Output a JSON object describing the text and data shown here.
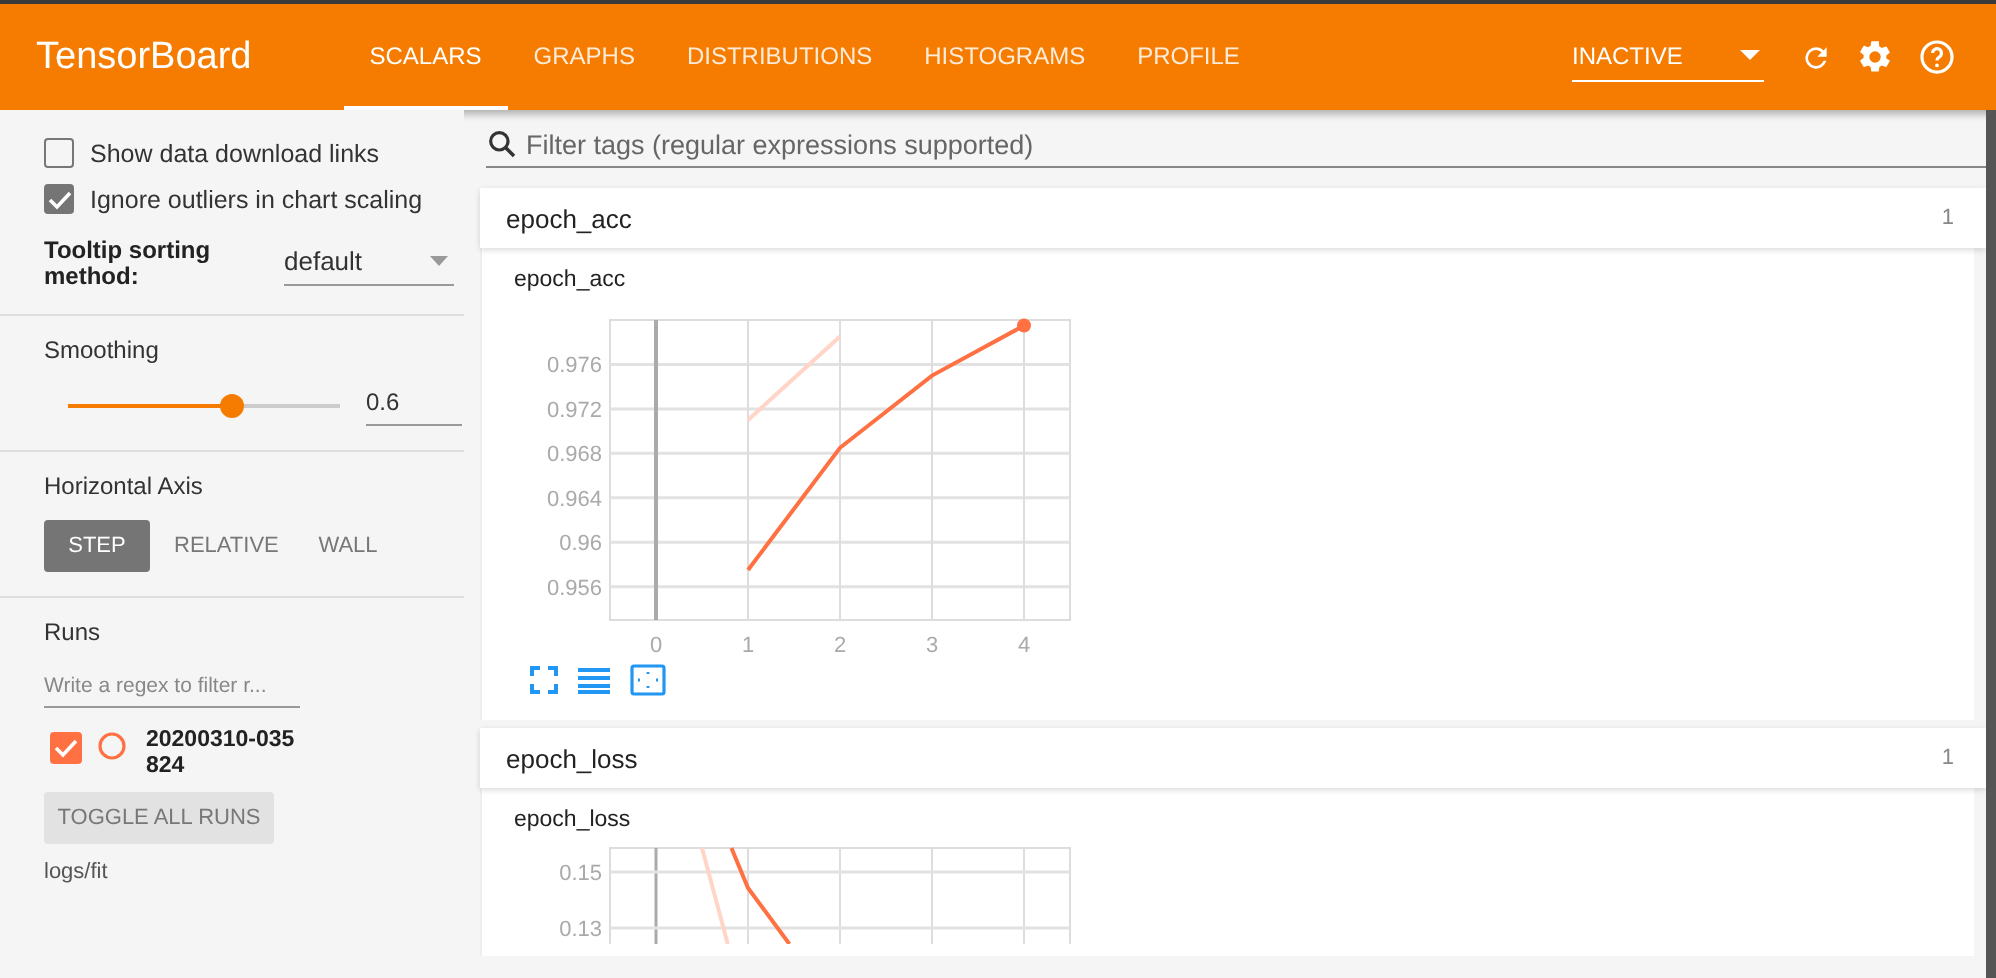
{
  "header": {
    "title": "TensorBoard",
    "tabs": [
      {
        "label": "SCALARS",
        "selected": true
      },
      {
        "label": "GRAPHS",
        "selected": false
      },
      {
        "label": "DISTRIBUTIONS",
        "selected": false
      },
      {
        "label": "HISTOGRAMS",
        "selected": false
      },
      {
        "label": "PROFILE",
        "selected": false
      }
    ],
    "run_select": {
      "value": "INACTIVE"
    }
  },
  "sidebar": {
    "options": [
      {
        "label": "Show data download links",
        "checked": false
      },
      {
        "label": "Ignore outliers in chart scaling",
        "checked": true
      }
    ],
    "tooltip_sorting": {
      "label": "Tooltip sorting method:",
      "value": "default"
    },
    "smoothing": {
      "label": "Smoothing",
      "level": 0.6,
      "value": "0.6"
    },
    "horizontal_axis": {
      "label": "Horizontal Axis",
      "options": [
        {
          "label": "STEP",
          "selected": true
        },
        {
          "label": "RELATIVE",
          "selected": false
        },
        {
          "label": "WALL",
          "selected": false
        }
      ]
    },
    "runs": {
      "label": "Runs",
      "placeholder": "Write a regex to filter r...",
      "items": [
        {
          "name": "20200310-035824",
          "checked": true,
          "color": "#ff7043"
        }
      ],
      "toggle_button": "TOGGLE ALL RUNS",
      "logdir": "logs/fit"
    }
  },
  "main": {
    "search": {
      "placeholder": "Filter tags (regular expressions supported)"
    },
    "groups": [
      {
        "name": "epoch_acc",
        "count": "1",
        "cards": [
          {
            "title": "epoch_acc",
            "chart_data": {
              "type": "line",
              "grid": true,
              "x": [
                1,
                2,
                3,
                4
              ],
              "xlim": [
                -0.5,
                4.5
              ],
              "ylim": [
                0.953,
                0.98
              ],
              "xticks": [
                0,
                1,
                2,
                3,
                4
              ],
              "yticks": [
                0.956,
                0.96,
                0.964,
                0.968,
                0.972,
                0.976
              ],
              "series": [
                {
                  "color": "#ff7043",
                  "values": [
                    0.9575,
                    0.9685,
                    0.975,
                    0.9795
                  ]
                },
                {
                  "color": "#ffd5c8",
                  "values": [
                    0.971,
                    0.9785,
                    null,
                    null
                  ]
                }
              ]
            }
          }
        ]
      },
      {
        "name": "epoch_loss",
        "count": "1",
        "cards": [
          {
            "title": "epoch_loss",
            "y_tick_labels": [
              "0.15",
              "0.13"
            ]
          }
        ]
      }
    ]
  }
}
